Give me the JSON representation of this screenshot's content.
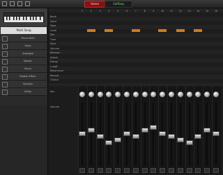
{
  "topbar": {
    "mode_label": "Home",
    "status_label": "SoftSeq",
    "icons": [
      "menu-icon",
      "save-icon",
      "settings-icon",
      "help-icon"
    ]
  },
  "left_panel": {
    "selected": "Multi Song",
    "items": [
      "Piano Multi",
      "Voice",
      "Arpeggio",
      "Master",
      "Drum",
      "Master Effect",
      "Remote",
      "Utility"
    ]
  },
  "mixer": {
    "channels": [
      "1",
      "2",
      "3",
      "4",
      "5",
      "6",
      "7",
      "8",
      "9",
      "10",
      "11",
      "12",
      "13",
      "14",
      "15",
      "16"
    ],
    "param_labels": [
      "Bank",
      "Voice",
      "Type",
      "Level",
      "Pan",
      "Tune",
      "Tone",
      "Volume",
      "Release",
      "Attack",
      "Decay",
      "Cutoff",
      "Resonance",
      "Reverb",
      "Chorus"
    ],
    "section_labels": [
      "Pan",
      "Volume"
    ],
    "orange_cells": [
      [
        3,
        1,
        6,
        9,
        11,
        13
      ]
    ]
  }
}
